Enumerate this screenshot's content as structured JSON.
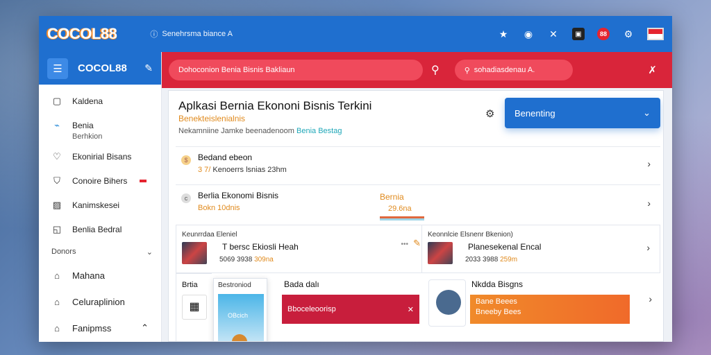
{
  "app": {
    "logo": "COCOL88",
    "top_title": "Senehrsma biance A"
  },
  "topbar_icons": [
    "star-icon",
    "shield-icon",
    "tools-icon",
    "terminal-icon",
    "alert-icon",
    "settings-icon",
    "flag-icon"
  ],
  "topbar_badge": "88",
  "sidebar": {
    "logo": "COCOL88",
    "items": [
      {
        "icon": "square-icon",
        "label": "Kaldena"
      },
      {
        "icon": "chart-icon",
        "label": "Benia",
        "sub": "Berhkion"
      },
      {
        "icon": "heart-icon",
        "label": "Ekonirial Bisans"
      },
      {
        "icon": "shield-icon",
        "label": "Conoire Bihers"
      },
      {
        "icon": "image-icon",
        "label": "Kanimskesei"
      },
      {
        "icon": "doc-icon",
        "label": "Benlia Bedral"
      }
    ],
    "section": "Donors",
    "items2": [
      {
        "icon": "home-icon",
        "label": "Mahana"
      },
      {
        "icon": "bell-icon",
        "label": "Celuraplinion"
      },
      {
        "icon": "home-icon",
        "label": "Fanipmss"
      }
    ]
  },
  "redbar": {
    "search1": "Dohoconion Benia Bisnis Bakliaun",
    "search2": "sohadiasdenau A."
  },
  "panel": {
    "title": "Aplkasi Bernia Ekononi Bisnis Terkini",
    "subtitle": "Benekteislenialnis",
    "desc": "Nekamniine Jamke beenadenoom",
    "desc_highlight": "Benia Bestag",
    "dropdown": "Benenting",
    "row1": {
      "title": "Bedand ebeon",
      "meta_pre": "3 7/",
      "meta": "Kenoerrs lsnias 23hm"
    },
    "row2": {
      "title": "Berlia Ekonomi Bisnis",
      "meta": "Bokn 10dnis",
      "right_title": "Bernia",
      "right_sub": "29.6na"
    },
    "news1": {
      "caption": "Keunrrdaa Eleniel",
      "title": "T bersc Ekiosli Heah",
      "date": "5069 3938",
      "tag": "309na"
    },
    "news2": {
      "caption": "Keonnlcie Elsnenr Bkenion)",
      "title": "Planesekenal Encal",
      "date": "2033 3988",
      "tag": "259m"
    },
    "bottom": {
      "left_label": "Brtia",
      "float_label": "Bestroniod",
      "float_sub": "OBcich",
      "red_title": "Bada dalı",
      "red_text": "Bboceleoorisp",
      "nb_title": "Nkdda Bisgns",
      "orange_text": "Bane Beees",
      "orange_text2": "Bneeby Bees"
    }
  }
}
